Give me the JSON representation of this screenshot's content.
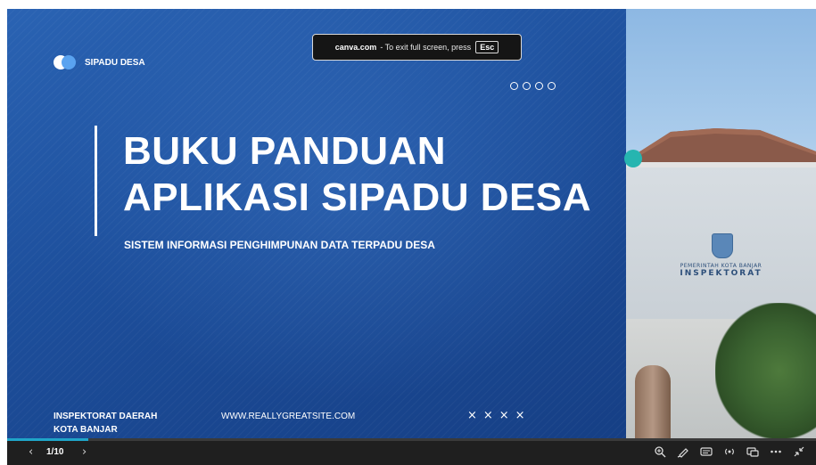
{
  "slide": {
    "brand_name": "SIPADU DESA",
    "title_line1": "BUKU PANDUAN",
    "title_line2": "APLIKASI SIPADU DESA",
    "subtitle": "SISTEM INFORMASI PENGHIMPUNAN DATA TERPADU DESA",
    "footer_org_line1": "INSPEKTORAT DAERAH",
    "footer_org_line2": "KOTA BANJAR",
    "footer_url": "WWW.REALLYGREATSITE.COM",
    "footer_marks": "××××",
    "photo_sign_small": "PEMERINTAH KOTA BANJAR",
    "photo_sign_big": "INSPEKTORAT"
  },
  "fullscreen_notice": {
    "site": "canva.com",
    "message": "- To exit full screen, press",
    "key": "Esc"
  },
  "toolbar": {
    "prev_icon": "chevron-left-icon",
    "next_icon": "chevron-right-icon",
    "page_indicator": "1/10",
    "progress": 0.1,
    "icons": [
      "zoom-icon",
      "draw-icon",
      "captions-icon",
      "broadcast-icon",
      "present-window-icon",
      "more-icon",
      "exit-fullscreen-icon"
    ]
  },
  "colors": {
    "slide_blue": "#1d4f9c",
    "accent_teal": "#26b5b0",
    "progress": "#1fa5c8",
    "toolbar_bg": "#1f1f1f"
  }
}
